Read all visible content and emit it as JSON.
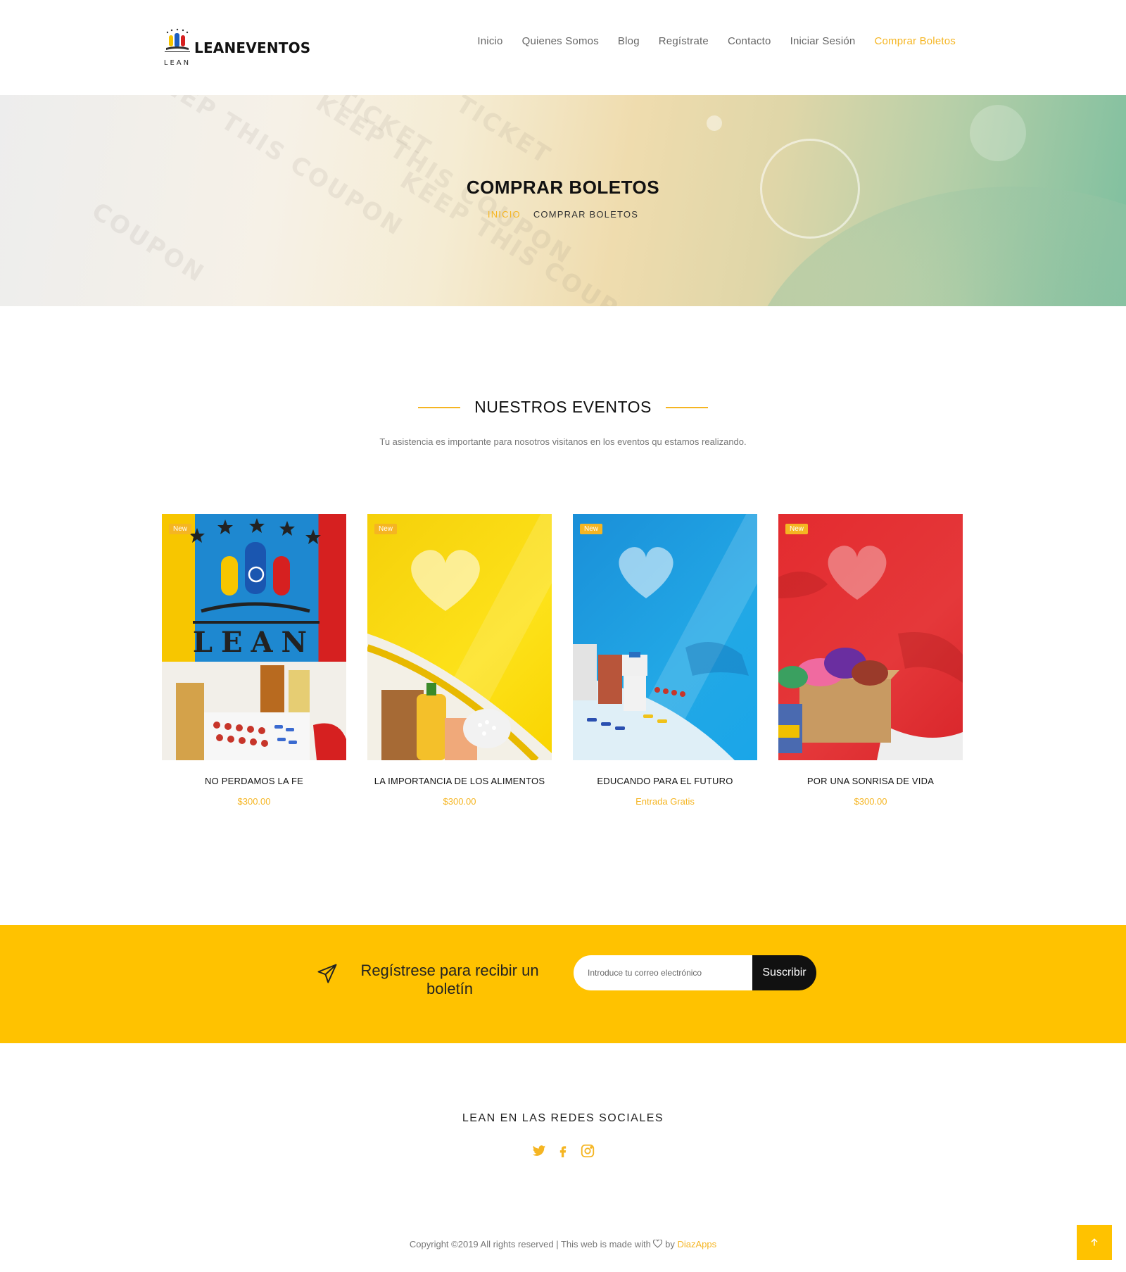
{
  "header": {
    "logo_text": "LEANEVENTOS",
    "logo_sub": "LEAN",
    "nav": [
      {
        "label": "Inicio",
        "active": false
      },
      {
        "label": "Quienes Somos",
        "active": false
      },
      {
        "label": "Blog",
        "active": false
      },
      {
        "label": "Regístrate",
        "active": false
      },
      {
        "label": "Contacto",
        "active": false
      },
      {
        "label": "Iniciar Sesión",
        "active": false
      },
      {
        "label": "Comprar Boletos",
        "active": true
      }
    ]
  },
  "hero": {
    "title": "COMPRAR BOLETOS",
    "breadcrumb_home": "INICIO",
    "breadcrumb_current": "COMPRAR BOLETOS"
  },
  "events_section": {
    "title": "NUESTROS EVENTOS",
    "subtitle": "Tu asistencia es importante para nosotros visitanos en los eventos qu estamos realizando."
  },
  "events": [
    {
      "badge": "New",
      "title": "NO PERDAMOS LA FE",
      "price": "$300.00",
      "bg": "#1e88d0",
      "image_logo": "LEAN"
    },
    {
      "badge": "New",
      "title": "LA IMPORTANCIA DE LOS ALIMENTOS",
      "price": "$300.00",
      "bg": "#fbd808"
    },
    {
      "badge": "New",
      "title": "EDUCANDO PARA EL FUTURO",
      "price": "Entrada Gratis",
      "bg": "#1e9fe0"
    },
    {
      "badge": "New",
      "title": "POR UNA SONRISA DE VIDA",
      "price": "$300.00",
      "bg": "#e32b2f"
    }
  ],
  "newsletter": {
    "text": "Regístrese para recibir un boletín",
    "placeholder": "Introduce tu correo electrónico",
    "button": "Suscribir"
  },
  "footer": {
    "social_title": "LEAN EN LAS REDES SOCIALES",
    "social_icons": [
      "twitter-icon",
      "facebook-icon",
      "instagram-icon"
    ],
    "copyright_prefix": "Copyright ©2019 All rights reserved | This web is made with",
    "copyright_by": "by",
    "copyright_brand": "DiazApps"
  },
  "colors": {
    "accent": "#f5b522",
    "newsletter_bg": "#ffc200",
    "dark": "#111111"
  }
}
